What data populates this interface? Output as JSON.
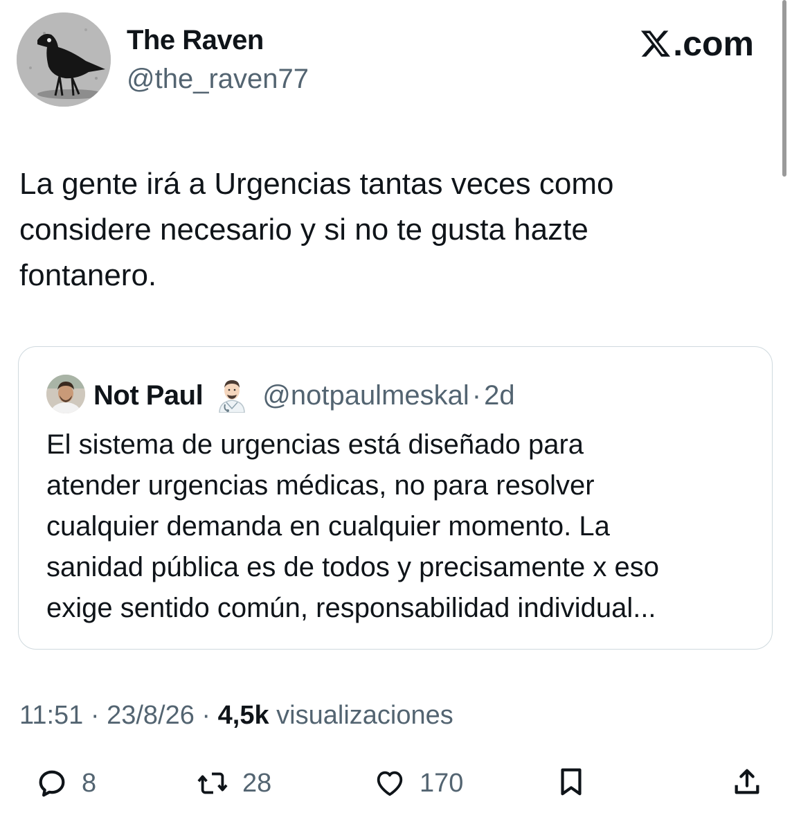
{
  "tweet": {
    "author_name": "The Raven",
    "author_handle": "@the_raven77",
    "source": ".com",
    "text_lines": [
      "La gente irá a Urgencias tantas veces como",
      "considere necesario y si no te gusta hazte",
      "fontanero."
    ],
    "time": "11:51",
    "date": "23/8/26",
    "views_count": "4,5k",
    "views_label": "visualizaciones",
    "separator": "·"
  },
  "quote": {
    "author_name": "Not Paul",
    "author_handle": "@notpaulmeskal",
    "age": "2d",
    "text_lines": [
      "El sistema de urgencias está diseñado para",
      "atender urgencias médicas, no para resolver",
      "cualquier demanda  en cualquier momento. La",
      "sanidad pública es de todos y precisamente x eso",
      "exige sentido común, responsabilidad individual..."
    ]
  },
  "actions": {
    "replies": "8",
    "reposts": "28",
    "likes": "170"
  },
  "icons": [
    "raven-avatar",
    "x-logo-icon",
    "doctor-emoji-icon",
    "reply-icon",
    "repost-icon",
    "like-icon",
    "bookmark-icon",
    "share-icon"
  ],
  "colors": {
    "text": "#0f1419",
    "secondary": "#536471",
    "border": "#cfd9de"
  }
}
